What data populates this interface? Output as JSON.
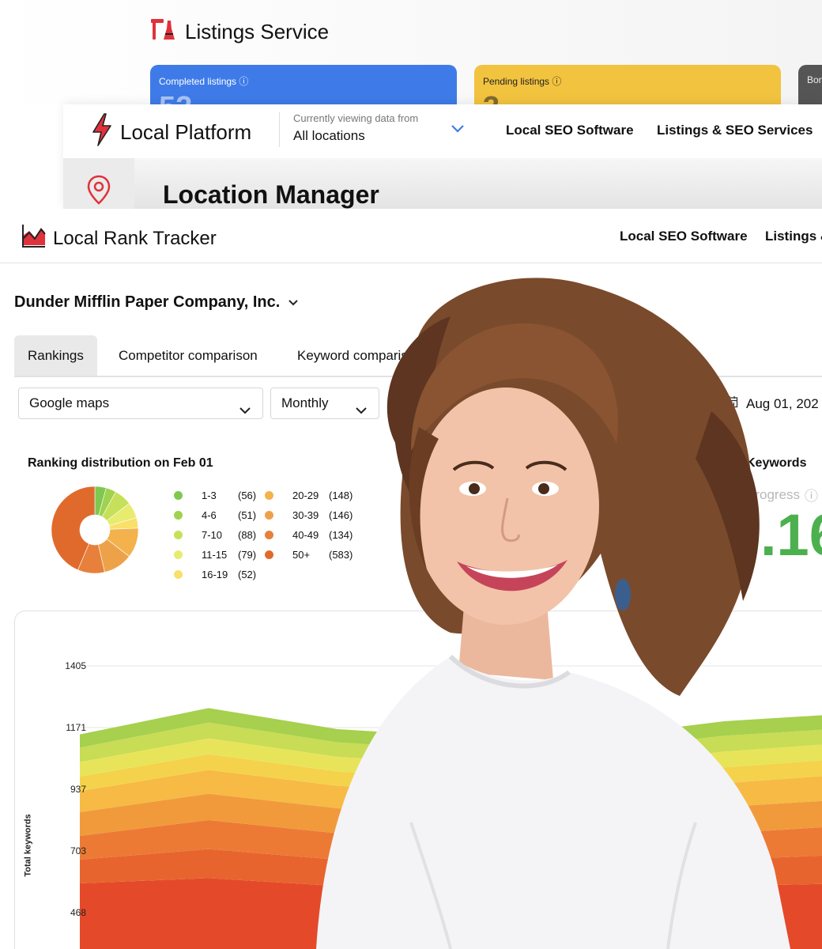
{
  "listings_service": {
    "title": "Listings Service",
    "cards": [
      {
        "label": "Completed listings",
        "value": "52"
      },
      {
        "label": "Pending listings",
        "value": "3"
      },
      {
        "label": "Bon",
        "value": ""
      }
    ]
  },
  "local_platform": {
    "brand": "Local Platform",
    "viewing_label": "Currently viewing data from",
    "viewing_value": "All locations",
    "nav": [
      "Local SEO Software",
      "Listings & SEO Services"
    ],
    "page_title": "Location Manager"
  },
  "rank_tracker": {
    "brand": "Local Rank Tracker",
    "nav": [
      "Local SEO Software",
      "Listings &"
    ],
    "company": "Dunder Mifflin Paper Company, Inc.",
    "tabs": [
      "Rankings",
      "Competitor comparison",
      "Keyword comparison"
    ],
    "selected_tab": "Rankings",
    "filters": {
      "source": "Google maps",
      "period": "Monthly",
      "date": "Aug 01, 202"
    },
    "distribution_title": "Ranking distribution on Feb 01",
    "keywords_title": "Keywords",
    "progress_label": "Progress",
    "progress_value": ".16"
  },
  "colors": {
    "blue": "#3f7be8",
    "yellow": "#f2c33f",
    "red_brand": "#e0323c",
    "green_value": "#4cb04f"
  },
  "icons": {
    "listings": "broom-icon",
    "platform": "bolt-icon",
    "tracker": "area-chart-icon",
    "location": "map-pin-icon"
  },
  "chart_data": [
    {
      "type": "pie",
      "title": "Ranking distribution on Feb 01",
      "categories": [
        "1-3",
        "4-6",
        "7-10",
        "11-15",
        "16-19",
        "20-29",
        "30-39",
        "40-49",
        "50+"
      ],
      "values": [
        56,
        51,
        88,
        79,
        52,
        148,
        146,
        134,
        583
      ],
      "colors": [
        "#7ec84f",
        "#9fd24e",
        "#c6e05a",
        "#e8ec6e",
        "#f8e06a",
        "#f3b24c",
        "#eda24a",
        "#e7803a",
        "#e06a2c"
      ],
      "legend": [
        {
          "label": "1-3",
          "count": "(56)"
        },
        {
          "label": "4-6",
          "count": "(51)"
        },
        {
          "label": "7-10",
          "count": "(88)"
        },
        {
          "label": "11-15",
          "count": "(79)"
        },
        {
          "label": "16-19",
          "count": "(52)"
        },
        {
          "label": "20-29",
          "count": "(148)"
        },
        {
          "label": "30-39",
          "count": "(146)"
        },
        {
          "label": "40-49",
          "count": "(134)"
        },
        {
          "label": "50+",
          "count": "(583)"
        }
      ]
    },
    {
      "type": "area",
      "ylabel": "Total keywords",
      "yticks": [
        1405,
        1171,
        937,
        703,
        468
      ],
      "ylim": [
        350,
        1550
      ],
      "x": [
        0,
        1,
        2,
        3,
        4,
        5,
        6
      ],
      "stacked": true,
      "series": [
        {
          "color": "#e44a2a",
          "values": [
            580,
            600,
            570,
            560,
            560,
            570,
            580
          ]
        },
        {
          "color": "#e8642f",
          "values": [
            90,
            110,
            100,
            95,
            95,
            100,
            110
          ]
        },
        {
          "color": "#ec7a35",
          "values": [
            90,
            110,
            100,
            95,
            95,
            100,
            110
          ]
        },
        {
          "color": "#f19a3c",
          "values": [
            90,
            100,
            95,
            90,
            90,
            100,
            100
          ]
        },
        {
          "color": "#f6ba45",
          "values": [
            80,
            90,
            85,
            80,
            80,
            90,
            95
          ]
        },
        {
          "color": "#f5d24c",
          "values": [
            55,
            60,
            55,
            55,
            55,
            60,
            60
          ]
        },
        {
          "color": "#e8e45a",
          "values": [
            55,
            60,
            55,
            55,
            55,
            60,
            60
          ]
        },
        {
          "color": "#c8dc55",
          "values": [
            55,
            60,
            55,
            55,
            55,
            60,
            55
          ]
        },
        {
          "color": "#a6d04e",
          "values": [
            50,
            55,
            50,
            50,
            50,
            55,
            55
          ]
        }
      ]
    }
  ]
}
